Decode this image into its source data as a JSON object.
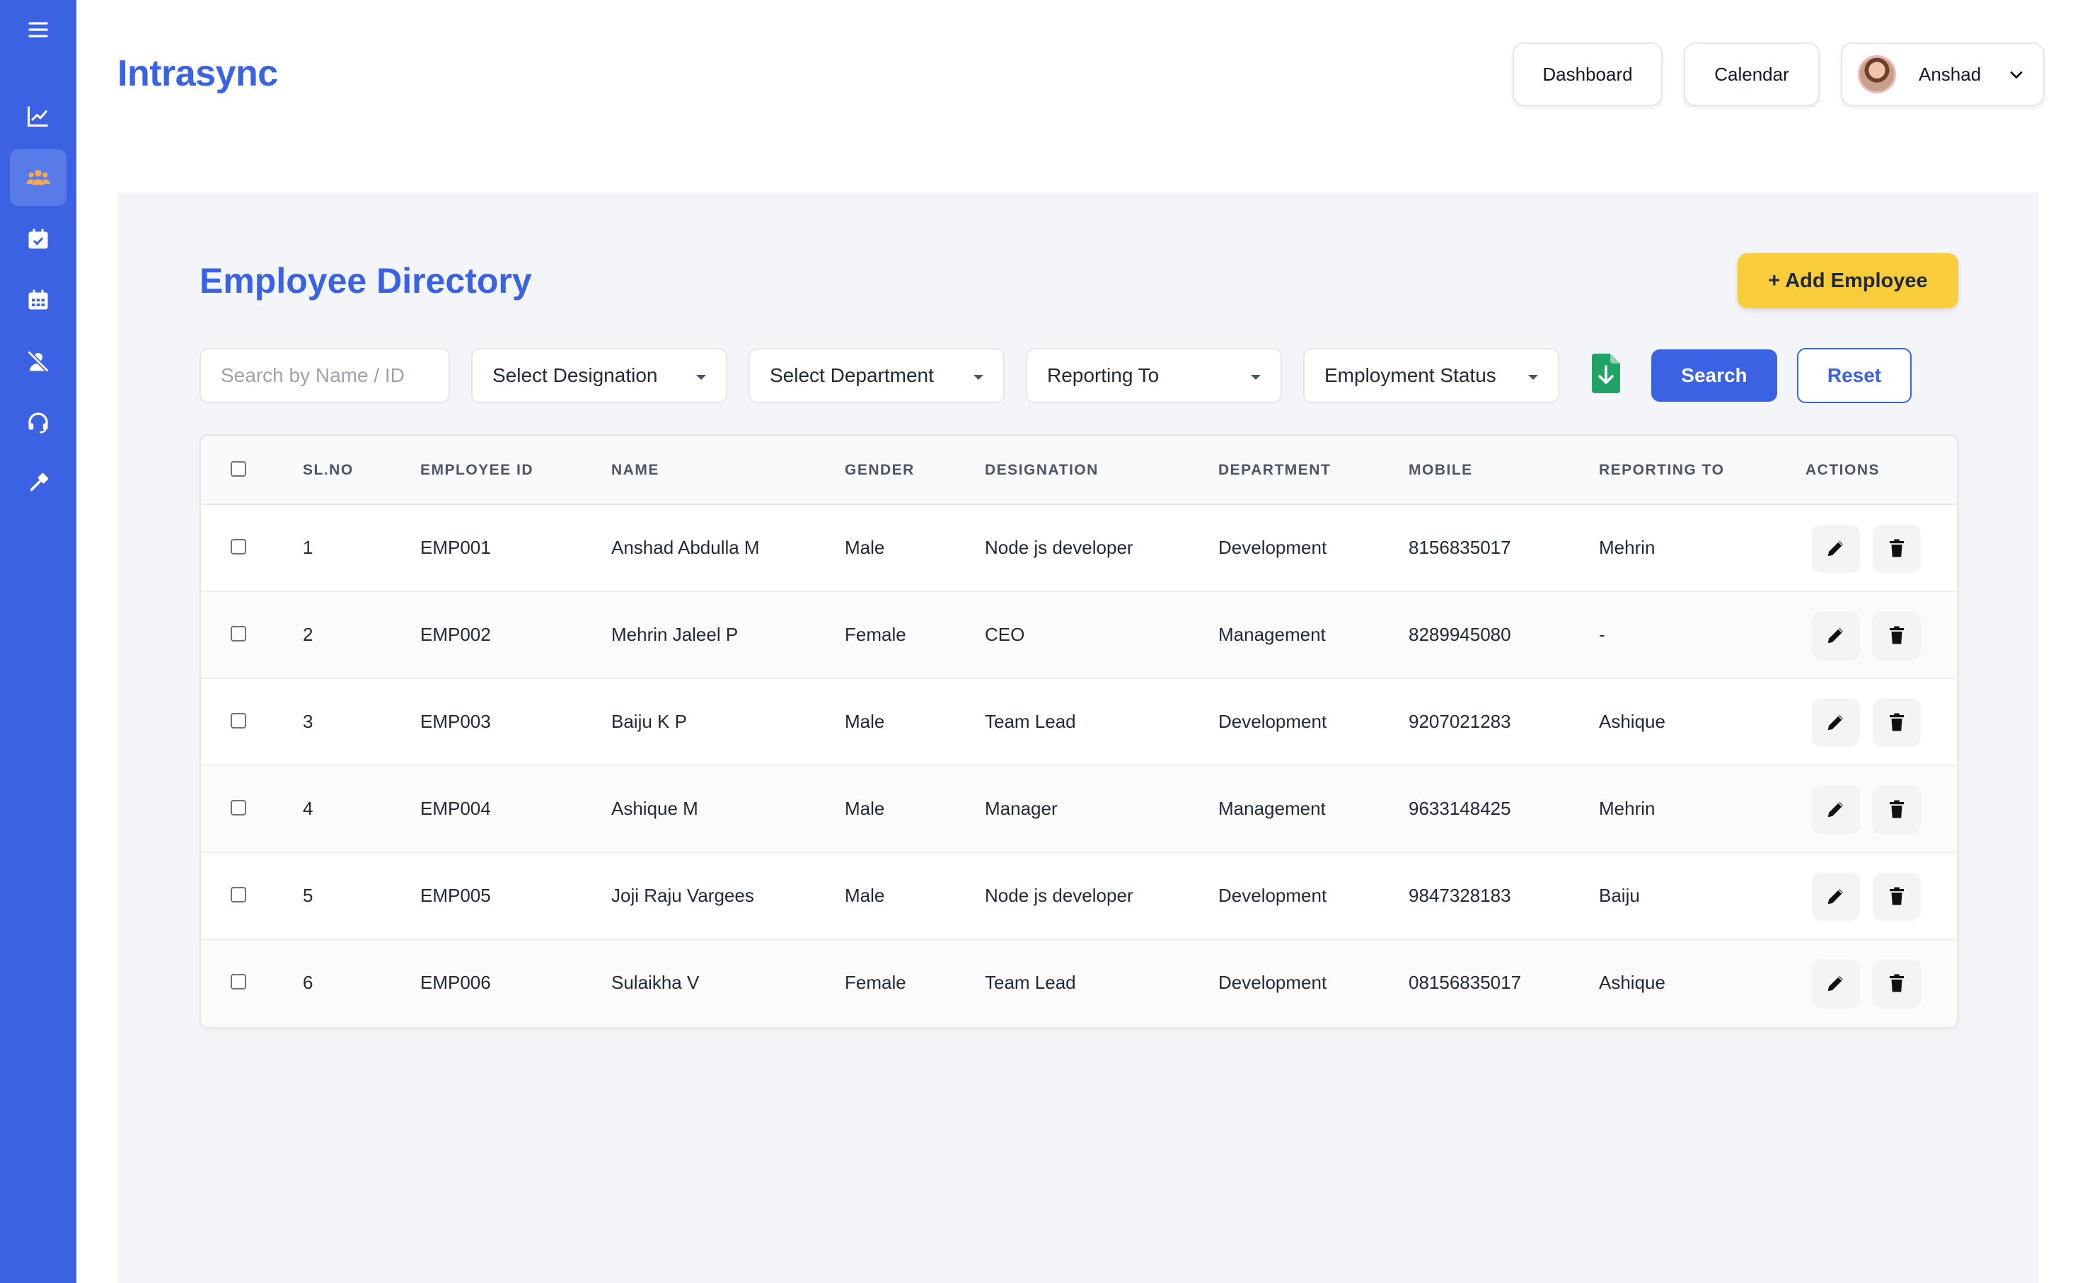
{
  "app": {
    "brand": "Intrasync"
  },
  "header": {
    "dashboard_label": "Dashboard",
    "calendar_label": "Calendar",
    "user_name": "Anshad"
  },
  "sidebar": {
    "items": [
      {
        "icon": "menu-icon"
      },
      {
        "icon": "chart-icon"
      },
      {
        "icon": "users-icon",
        "active": true
      },
      {
        "icon": "calendar-check-icon"
      },
      {
        "icon": "calendar-icon"
      },
      {
        "icon": "user-slash-icon"
      },
      {
        "icon": "headset-icon"
      },
      {
        "icon": "gavel-icon"
      }
    ]
  },
  "page": {
    "title": "Employee Directory",
    "add_button": "+ Add Employee"
  },
  "filters": {
    "search_placeholder": "Search by Name / ID",
    "designation": "Select Designation",
    "department": "Select Department",
    "reporting_to": "Reporting To",
    "employment_status": "Employment Status",
    "search_button": "Search",
    "reset_button": "Reset"
  },
  "table": {
    "headers": [
      "SL.NO",
      "EMPLOYEE ID",
      "NAME",
      "GENDER",
      "DESIGNATION",
      "DEPARTMENT",
      "MOBILE",
      "REPORTING TO",
      "ACTIONS"
    ],
    "rows": [
      {
        "sl": "1",
        "id": "EMP001",
        "name": "Anshad Abdulla M",
        "gender": "Male",
        "designation": "Node js developer",
        "department": "Development",
        "mobile": "8156835017",
        "reporting": "Mehrin"
      },
      {
        "sl": "2",
        "id": "EMP002",
        "name": "Mehrin Jaleel P",
        "gender": "Female",
        "designation": "CEO",
        "department": "Management",
        "mobile": "8289945080",
        "reporting": "-"
      },
      {
        "sl": "3",
        "id": "EMP003",
        "name": "Baiju K P",
        "gender": "Male",
        "designation": "Team Lead",
        "department": "Development",
        "mobile": "9207021283",
        "reporting": "Ashique"
      },
      {
        "sl": "4",
        "id": "EMP004",
        "name": "Ashique M",
        "gender": "Male",
        "designation": "Manager",
        "department": "Management",
        "mobile": "9633148425",
        "reporting": "Mehrin"
      },
      {
        "sl": "5",
        "id": "EMP005",
        "name": "Joji Raju Vargees",
        "gender": "Male",
        "designation": "Node js developer",
        "department": "Development",
        "mobile": "9847328183",
        "reporting": "Baiju"
      },
      {
        "sl": "6",
        "id": "EMP006",
        "name": "Sulaikha V",
        "gender": "Female",
        "designation": "Team Lead",
        "department": "Development",
        "mobile": "08156835017",
        "reporting": "Ashique"
      }
    ]
  },
  "colors": {
    "primary": "#3a62e3",
    "accent_yellow": "#f8cc3a",
    "active_icon": "#f5a855",
    "excel_green": "#21a366"
  }
}
